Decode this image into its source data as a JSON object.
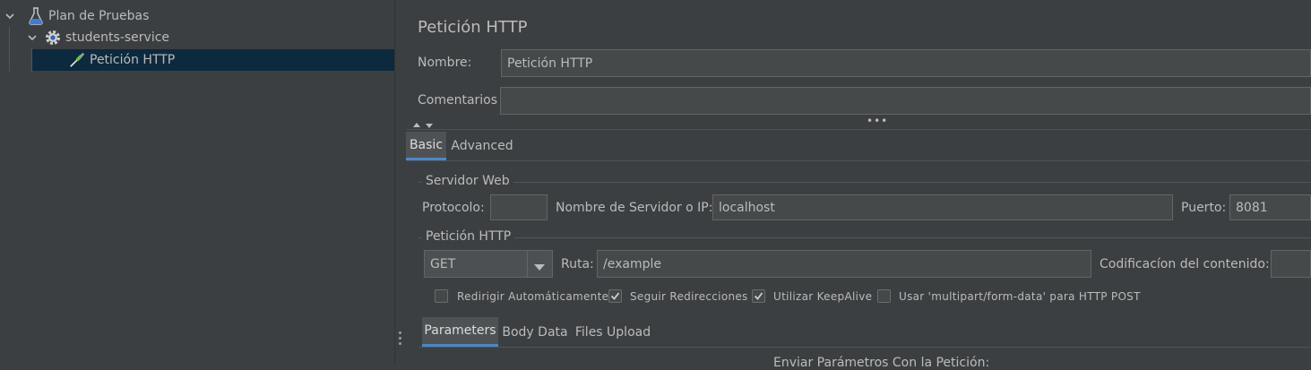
{
  "tree": {
    "items": [
      {
        "label": "Plan de Pruebas",
        "icon": "flask-icon",
        "expanded": true
      },
      {
        "label": "students-service",
        "icon": "gear-icon",
        "expanded": true
      },
      {
        "label": "Petición HTTP",
        "icon": "pipette-icon",
        "selected": true
      }
    ]
  },
  "panel": {
    "title": "Petición HTTP",
    "name_label": "Nombre:",
    "name_value": "Petición HTTP",
    "comments_label": "Comentarios",
    "comments_value": ""
  },
  "tabs": [
    {
      "label": "Basic",
      "active": true
    },
    {
      "label": "Advanced",
      "active": false
    }
  ],
  "server": {
    "group_title": "Servidor Web",
    "protocol_label": "Protocolo:",
    "protocol_value": "",
    "server_label": "Nombre de Servidor o IP:",
    "server_value": "localhost",
    "port_label": "Puerto:",
    "port_value": "8081"
  },
  "request": {
    "group_title": "Petición HTTP",
    "method": "GET",
    "path_label": "Ruta:",
    "path_value": "/example",
    "encoding_label": "Codificacíon del contenido:",
    "encoding_value": ""
  },
  "options": [
    {
      "label": "Redirigir Automáticamente",
      "checked": false
    },
    {
      "label": "Seguir Redirecciones",
      "checked": true
    },
    {
      "label": "Utilizar KeepAlive",
      "checked": true
    },
    {
      "label": "Usar 'multipart/form-data' para HTTP POST",
      "checked": false
    }
  ],
  "sub_tabs": [
    {
      "label": "Parameters",
      "active": true
    },
    {
      "label": "Body Data",
      "active": false
    },
    {
      "label": "Files Upload",
      "active": false
    }
  ],
  "params_caption": "Enviar Parámetros Con la Petición:",
  "colors": {
    "background": "#3c3f41",
    "selection": "#0d293e",
    "accent": "#4a88c7",
    "field_bg": "#45494a"
  }
}
